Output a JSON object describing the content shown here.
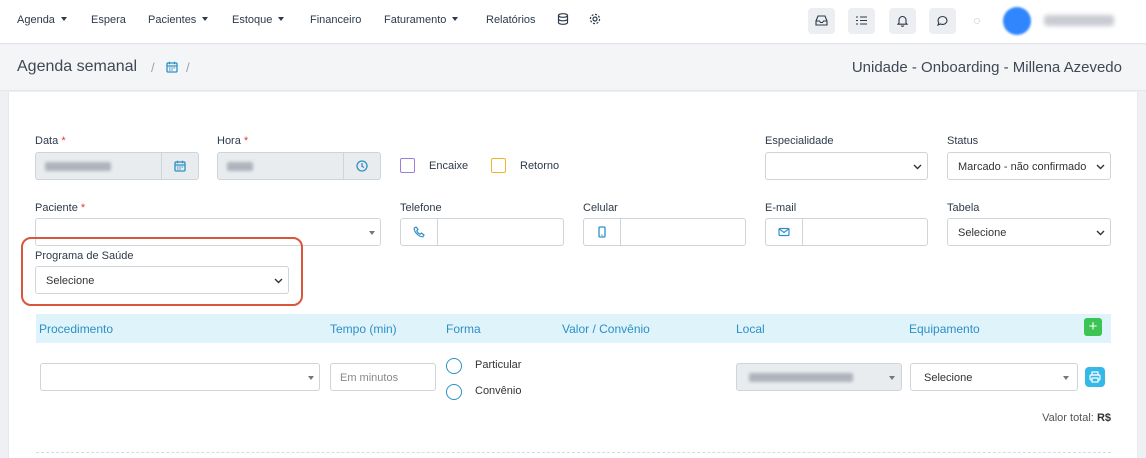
{
  "nav": {
    "items": [
      {
        "label": "Agenda",
        "dropdown": true
      },
      {
        "label": "Espera",
        "dropdown": false
      },
      {
        "label": "Pacientes",
        "dropdown": true
      },
      {
        "label": "Estoque",
        "dropdown": true
      },
      {
        "label": "Financeiro",
        "dropdown": false
      },
      {
        "label": "Faturamento",
        "dropdown": true
      },
      {
        "label": "Relatórios",
        "dropdown": false
      }
    ],
    "extra_icons": [
      "database-icon",
      "settings-icon"
    ],
    "toolbar_icons": [
      "inbox-icon",
      "task-list-icon",
      "bell-icon",
      "chat-icon"
    ],
    "avatar_color": "#2f86ff"
  },
  "breadcrumb": {
    "title": "Agenda semanal",
    "separator": "/",
    "icon": "calendar-icon",
    "unit": "Unidade - Onboarding - Millena Azevedo"
  },
  "form": {
    "data_label": "Data",
    "hora_label": "Hora",
    "required_mark": "*",
    "encaixe_label": "Encaixe",
    "encaixe_color": "#9b7fe0",
    "retorno_label": "Retorno",
    "retorno_color": "#f0b429",
    "especialidade_label": "Especialidade",
    "especialidade_value": "",
    "status_label": "Status",
    "status_value": "Marcado - não confirmado",
    "paciente_label": "Paciente",
    "telefone_label": "Telefone",
    "celular_label": "Celular",
    "email_label": "E-mail",
    "tabela_label": "Tabela",
    "tabela_value": "Selecione",
    "programa_label": "Programa de Saúde",
    "programa_value": "Selecione"
  },
  "procedures": {
    "headers": {
      "procedimento": "Procedimento",
      "tempo": "Tempo (min)",
      "forma": "Forma",
      "valor": "Valor / Convênio",
      "local": "Local",
      "equipamento": "Equipamento"
    },
    "tempo_placeholder": "Em minutos",
    "forma_options": [
      "Particular",
      "Convênio"
    ],
    "equipamento_value": "Selecione",
    "add_label": "+",
    "total_label": "Valor total:",
    "total_currency": "R$"
  },
  "colors": {
    "accent": "#2d90c5",
    "header_bg": "#dff3fb",
    "highlight": "#d9553b",
    "add_green": "#3bc453",
    "print_blue": "#34b8e8"
  }
}
